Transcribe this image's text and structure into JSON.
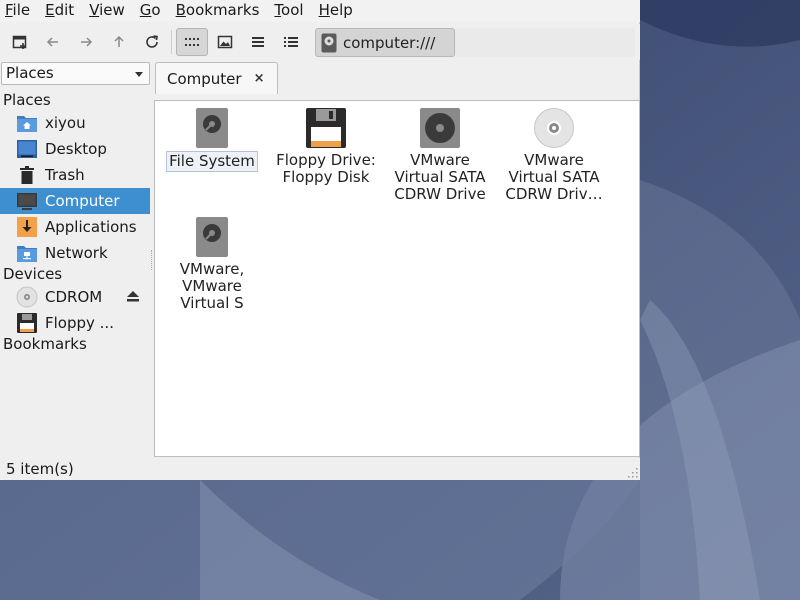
{
  "menubar": {
    "items": [
      {
        "label": "File",
        "ul": "F",
        "rest": "ile"
      },
      {
        "label": "Edit",
        "ul": "E",
        "rest": "dit"
      },
      {
        "label": "View",
        "ul": "V",
        "rest": "iew"
      },
      {
        "label": "Go",
        "ul": "G",
        "rest": "o"
      },
      {
        "label": "Bookmarks",
        "ul": "B",
        "rest": "ookmarks"
      },
      {
        "label": "Tool",
        "ul": "T",
        "rest": "ool"
      },
      {
        "label": "Help",
        "ul": "H",
        "rest": "elp"
      }
    ]
  },
  "toolbar": {
    "new_tab_icon": "new-tab-icon",
    "back_icon": "arrow-left-icon",
    "forward_icon": "arrow-right-icon",
    "up_icon": "arrow-up-icon",
    "reload_icon": "reload-icon",
    "view_icons_icon": "icon-view-icon",
    "view_thumbnails_icon": "thumbnail-view-icon",
    "view_compact_icon": "compact-view-icon",
    "view_list_icon": "detailed-list-icon",
    "location": "computer:///"
  },
  "sidepane": {
    "selector": "Places",
    "places_header": "Places",
    "places": [
      {
        "label": "xiyou",
        "icon": "home-folder-icon"
      },
      {
        "label": "Desktop",
        "icon": "desktop-icon"
      },
      {
        "label": "Trash",
        "icon": "trash-icon"
      },
      {
        "label": "Computer",
        "icon": "computer-icon",
        "selected": true
      },
      {
        "label": "Applications",
        "icon": "applications-icon"
      },
      {
        "label": "Network",
        "icon": "network-folder-icon"
      }
    ],
    "devices_header": "Devices",
    "devices": [
      {
        "label": "CDROM",
        "icon": "optical-disc-icon",
        "eject": true
      },
      {
        "label": "Floppy ...",
        "icon": "floppy-icon"
      }
    ],
    "bookmarks_header": "Bookmarks"
  },
  "tabs": [
    {
      "label": "Computer",
      "close": "×"
    }
  ],
  "content": {
    "items": [
      {
        "label": "File System",
        "icon": "harddisk-icon"
      },
      {
        "label": "Floppy Drive: Floppy Disk",
        "line1": "Floppy Drive:",
        "line2": "Floppy Disk",
        "icon": "floppy-icon"
      },
      {
        "line1": "VMware",
        "line2": "Virtual SATA",
        "line3": "CDRW Drive",
        "icon": "optical-drive-icon"
      },
      {
        "line1": "VMware",
        "line2": "Virtual SATA",
        "line3": "CDRW Driv…",
        "icon": "optical-disc-icon"
      },
      {
        "line1": "VMware,",
        "line2": "VMware",
        "line3": "Virtual S",
        "icon": "harddisk-icon"
      }
    ]
  },
  "status": {
    "text": "5 item(s)"
  },
  "colors": {
    "selection": "#3d8fcf",
    "desktop_bg": "#4a5a7c"
  }
}
